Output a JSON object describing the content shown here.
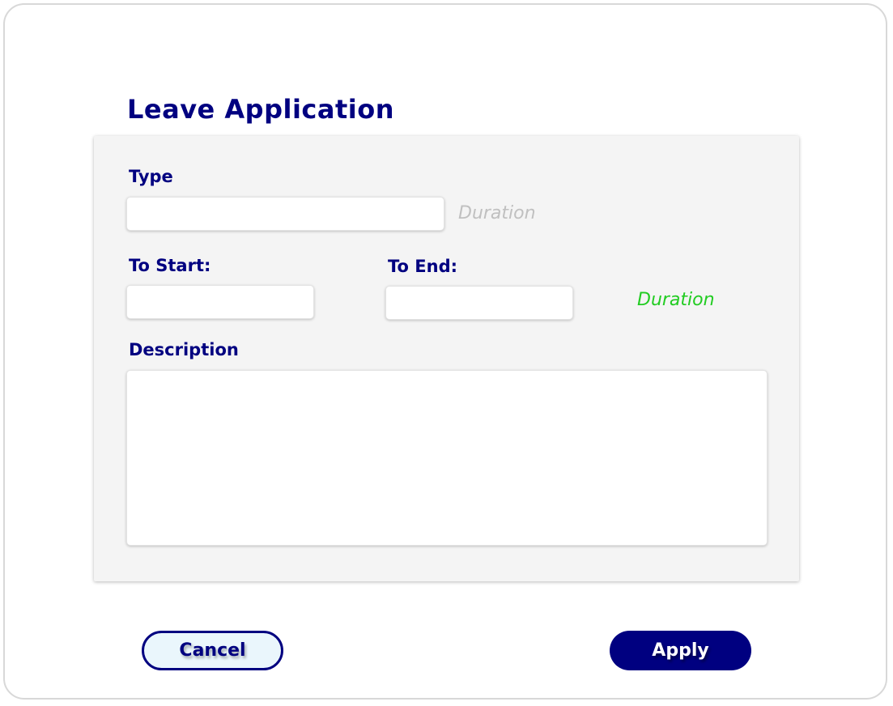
{
  "page": {
    "title": "Leave Application"
  },
  "form": {
    "type": {
      "label": "Type",
      "value": "",
      "hint": "Duration",
      "hint_color": "#c0c0c0"
    },
    "start": {
      "label": "To Start:",
      "value": ""
    },
    "end": {
      "label": "To End:",
      "value": ""
    },
    "duration": {
      "text": "Duration",
      "color": "#22cc22"
    },
    "description": {
      "label": "Description",
      "value": ""
    }
  },
  "actions": {
    "cancel_label": "Cancel",
    "apply_label": "Apply"
  },
  "colors": {
    "primary": "#000080",
    "panel_bg": "#f4f4f4",
    "cancel_bg": "#eaf6fc"
  }
}
